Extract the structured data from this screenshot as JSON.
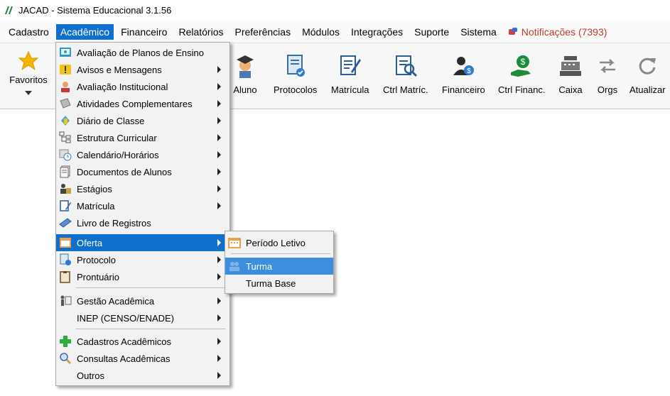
{
  "titlebar": {
    "title": "JACAD - Sistema Educacional 3.1.56",
    "logo_icon": "jacad-logo-icon"
  },
  "menubar": {
    "items": [
      {
        "label": "Cadastro"
      },
      {
        "label": "Acadêmico",
        "active": true
      },
      {
        "label": "Financeiro"
      },
      {
        "label": "Relatórios"
      },
      {
        "label": "Preferências"
      },
      {
        "label": "Módulos"
      },
      {
        "label": "Integrações"
      },
      {
        "label": "Suporte"
      },
      {
        "label": "Sistema"
      }
    ],
    "notifications": "Notificações (7393)"
  },
  "toolbar": {
    "favorites": "Favoritos",
    "buttons": [
      {
        "label": "Aluno",
        "icon": "student-icon"
      },
      {
        "label": "Protocolos",
        "icon": "protocol-icon"
      },
      {
        "label": "Matrícula",
        "icon": "enrollment-icon"
      },
      {
        "label": "Ctrl Matríc.",
        "icon": "enrollment-control-icon"
      },
      {
        "label": "Financeiro",
        "icon": "financial-icon"
      },
      {
        "label": "Ctrl Financ.",
        "icon": "financial-control-icon"
      },
      {
        "label": "Caixa",
        "icon": "cash-register-icon"
      },
      {
        "label": "Orgs",
        "icon": "swap-arrows-icon"
      },
      {
        "label": "Atualizar",
        "icon": "refresh-icon"
      }
    ]
  },
  "academic_menu": {
    "items": [
      {
        "label": "Avaliação de Planos de Ensino",
        "icon": "plan-evaluation-icon",
        "submenu": false
      },
      {
        "label": "Avisos e Mensagens",
        "icon": "warning-icon",
        "submenu": true
      },
      {
        "label": "Avaliação Institucional",
        "icon": "person-icon",
        "submenu": true
      },
      {
        "label": "Atividades Complementares",
        "icon": "activities-icon",
        "submenu": true
      },
      {
        "label": "Diário de Classe",
        "icon": "class-diary-icon",
        "submenu": true
      },
      {
        "label": "Estrutura Curricular",
        "icon": "structure-icon",
        "submenu": true
      },
      {
        "label": "Calendário/Horários",
        "icon": "calendar-clock-icon",
        "submenu": true
      },
      {
        "label": "Documentos de Alunos",
        "icon": "documents-icon",
        "submenu": true
      },
      {
        "label": "Estágios",
        "icon": "internship-icon",
        "submenu": true
      },
      {
        "label": "Matrícula",
        "icon": "enrollment-icon",
        "submenu": true
      },
      {
        "label": "Livro de Registros",
        "icon": "register-book-icon",
        "submenu": false
      },
      {
        "label": "Oferta",
        "icon": "offer-calendar-icon",
        "submenu": true,
        "highlighted": true
      },
      {
        "label": "Protocolo",
        "icon": "protocol-icon",
        "submenu": true
      },
      {
        "label": "Prontuário",
        "icon": "clipboard-icon",
        "submenu": true
      },
      {
        "label": "Gestão Acadêmica",
        "icon": "management-icon",
        "submenu": true
      },
      {
        "label": "INEP (CENSO/ENADE)",
        "icon": "",
        "submenu": true
      },
      {
        "label": "Cadastros Acadêmicos",
        "icon": "plus-icon",
        "submenu": true
      },
      {
        "label": "Consultas Acadêmicas",
        "icon": "magnifier-icon",
        "submenu": true
      },
      {
        "label": "Outros",
        "icon": "",
        "submenu": true
      }
    ]
  },
  "oferta_submenu": {
    "items": [
      {
        "label": "Período Letivo",
        "icon": "calendar-icon"
      },
      {
        "label": "Turma",
        "icon": "group-icon",
        "highlighted": true
      },
      {
        "label": "Turma Base",
        "icon": ""
      }
    ]
  }
}
